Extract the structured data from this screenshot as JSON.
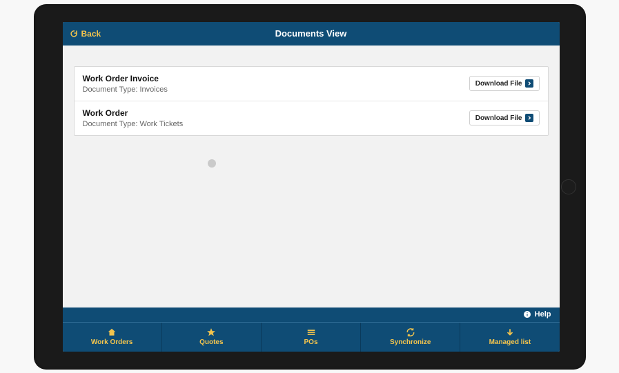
{
  "header": {
    "back_label": "Back",
    "title": "Documents View"
  },
  "documents": [
    {
      "title": "Work Order Invoice",
      "type_label": "Document Type:",
      "type_value": "Invoices",
      "download_label": "Download File"
    },
    {
      "title": "Work Order",
      "type_label": "Document Type:",
      "type_value": "Work Tickets",
      "download_label": "Download File"
    }
  ],
  "help": {
    "label": "Help"
  },
  "tabs": [
    {
      "label": "Work Orders"
    },
    {
      "label": "Quotes"
    },
    {
      "label": "POs"
    },
    {
      "label": "Synchronize"
    },
    {
      "label": "Managed list"
    }
  ]
}
